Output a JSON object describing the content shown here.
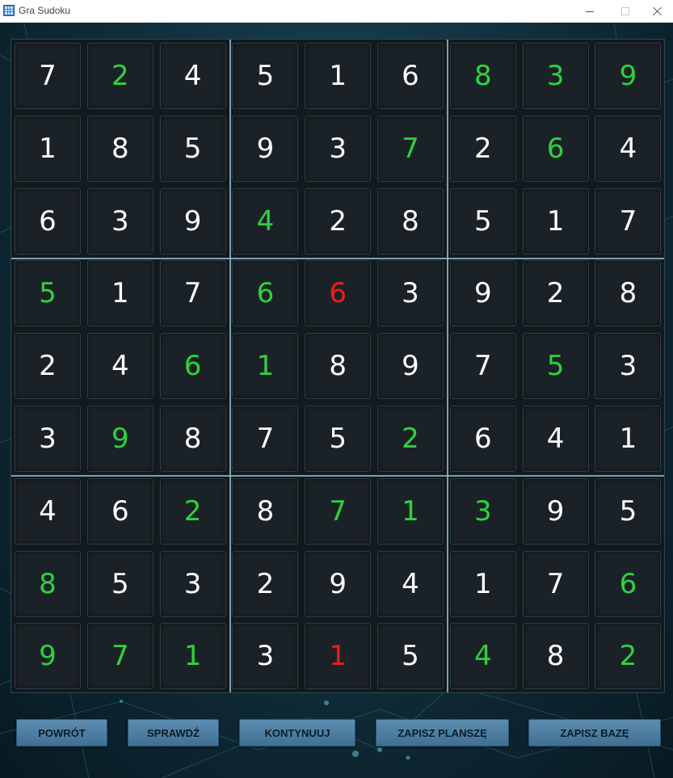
{
  "window": {
    "title": "Gra Sudoku"
  },
  "grid": [
    [
      7,
      2,
      4,
      5,
      1,
      6,
      8,
      3,
      9
    ],
    [
      1,
      8,
      5,
      9,
      3,
      7,
      2,
      6,
      4
    ],
    [
      6,
      3,
      9,
      4,
      2,
      8,
      5,
      1,
      7
    ],
    [
      5,
      1,
      7,
      6,
      6,
      3,
      9,
      2,
      8
    ],
    [
      2,
      4,
      6,
      1,
      8,
      9,
      7,
      5,
      3
    ],
    [
      3,
      9,
      8,
      7,
      5,
      2,
      6,
      4,
      1
    ],
    [
      4,
      6,
      2,
      8,
      7,
      1,
      3,
      9,
      5
    ],
    [
      8,
      5,
      3,
      2,
      9,
      4,
      1,
      7,
      6
    ],
    [
      9,
      7,
      1,
      3,
      1,
      5,
      4,
      8,
      2
    ]
  ],
  "cell_states": [
    [
      "user",
      "given",
      "user",
      "user",
      "user",
      "user",
      "given",
      "given",
      "given"
    ],
    [
      "user",
      "user",
      "user",
      "user",
      "user",
      "given",
      "user",
      "given",
      "user"
    ],
    [
      "user",
      "user",
      "user",
      "given",
      "user",
      "user",
      "user",
      "user",
      "user"
    ],
    [
      "given",
      "user",
      "user",
      "given",
      "conflict",
      "user",
      "user",
      "user",
      "user"
    ],
    [
      "user",
      "user",
      "given",
      "given",
      "user",
      "user",
      "user",
      "given",
      "user"
    ],
    [
      "user",
      "given",
      "user",
      "user",
      "user",
      "given",
      "user",
      "user",
      "user"
    ],
    [
      "user",
      "user",
      "given",
      "user",
      "given",
      "given",
      "given",
      "user",
      "user"
    ],
    [
      "given",
      "user",
      "user",
      "user",
      "user",
      "user",
      "user",
      "user",
      "given"
    ],
    [
      "given",
      "given",
      "given",
      "user",
      "conflict",
      "user",
      "given",
      "user",
      "given"
    ]
  ],
  "colors": {
    "user_digit": "#ffffff",
    "given_digit": "#2fd23d",
    "conflict_digit": "#ee1c1c",
    "button_bg": "#4f80a3",
    "background": "#143644"
  },
  "buttons": [
    {
      "key": "back",
      "label": "POWRÓT"
    },
    {
      "key": "check",
      "label": "SPRAWDŹ"
    },
    {
      "key": "continue",
      "label": "KONTYNUUJ"
    },
    {
      "key": "save-board",
      "label": "ZAPISZ PLANSZĘ"
    },
    {
      "key": "save-database",
      "label": "ZAPISZ BAZĘ"
    }
  ]
}
